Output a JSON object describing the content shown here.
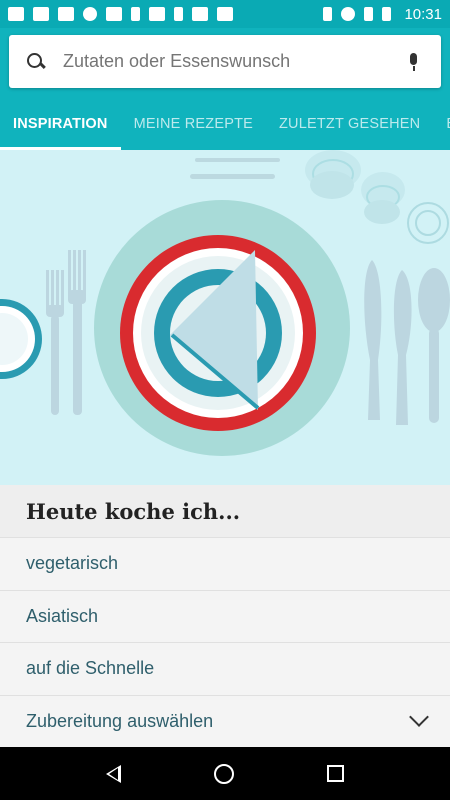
{
  "status_bar": {
    "time": "10:31",
    "left_icons": [
      "chat-icon",
      "image-icon",
      "checkbox-icon",
      "cloud-upload-icon",
      "calendar-icon",
      "download-icon",
      "square-icon",
      "game-icon",
      "gala-icon",
      "checkbox-icon"
    ],
    "right_icons": [
      "bluetooth-icon",
      "wifi-icon",
      "signal-icon",
      "battery-icon"
    ]
  },
  "search": {
    "placeholder": "Zutaten oder Essenswunsch"
  },
  "tabs": [
    {
      "label": "INSPIRATION",
      "active": true
    },
    {
      "label": "MEINE REZEPTE",
      "active": false
    },
    {
      "label": "ZULETZT GESEHEN",
      "active": false
    },
    {
      "label": "EI",
      "active": false
    }
  ],
  "hero": {
    "illustration": "table-setting-illustration"
  },
  "sheet": {
    "title": "Heute koche ich...",
    "options": [
      {
        "label": "vegetarisch"
      },
      {
        "label": "Asiatisch"
      },
      {
        "label": "auf die Schnelle"
      },
      {
        "label": "Zubereitung auswählen",
        "icon": "chevron-down-icon"
      }
    ]
  },
  "nav": {
    "buttons": [
      "back-icon",
      "home-icon",
      "recents-icon"
    ]
  },
  "colors": {
    "accent": "#10b3bd",
    "status_bar": "#0aaab4",
    "hero_bg": "#d2f2f6",
    "plate_red": "#d92b2f",
    "plate_teal": "#2a9bb1"
  }
}
